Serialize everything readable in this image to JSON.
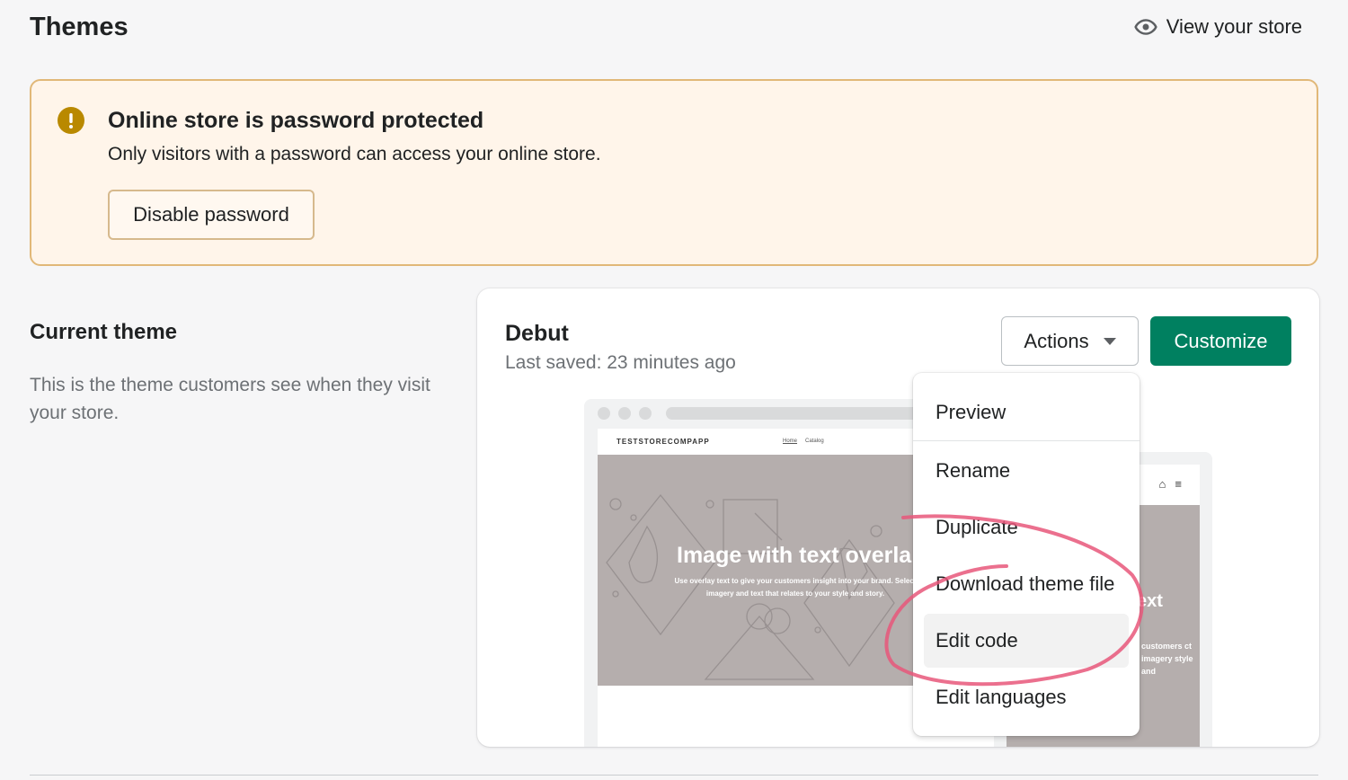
{
  "header": {
    "title": "Themes",
    "view_store_label": "View your store"
  },
  "banner": {
    "title": "Online store is password protected",
    "text": "Only visitors with a password can access your online store.",
    "button_label": "Disable password"
  },
  "current_theme": {
    "section_title": "Current theme",
    "section_description": "This is the theme customers see when they visit your store.",
    "theme_name": "Debut",
    "last_saved": "Last saved: 23 minutes ago",
    "actions_label": "Actions",
    "customize_label": "Customize"
  },
  "preview": {
    "store_name": "TESTSTORECOMPAPP",
    "nav": [
      "Home",
      "Catalog"
    ],
    "hero_title": "Image with text overla",
    "hero_subtitle": "Use overlay text to give your customers insight into your brand. Select imagery and text that relates to your style and story.",
    "mobile_title": "ext",
    "mobile_subtitle": "customers ct imagery style and"
  },
  "actions_menu": {
    "items": [
      "Preview",
      "Rename",
      "Duplicate",
      "Download theme file",
      "Edit code",
      "Edit languages"
    ],
    "highlighted": "Edit code"
  },
  "colors": {
    "primary": "#008060",
    "banner_bg": "#fff5ea",
    "banner_border": "#e1b878",
    "warning_icon": "#b98900",
    "annotation": "#e8577a"
  }
}
